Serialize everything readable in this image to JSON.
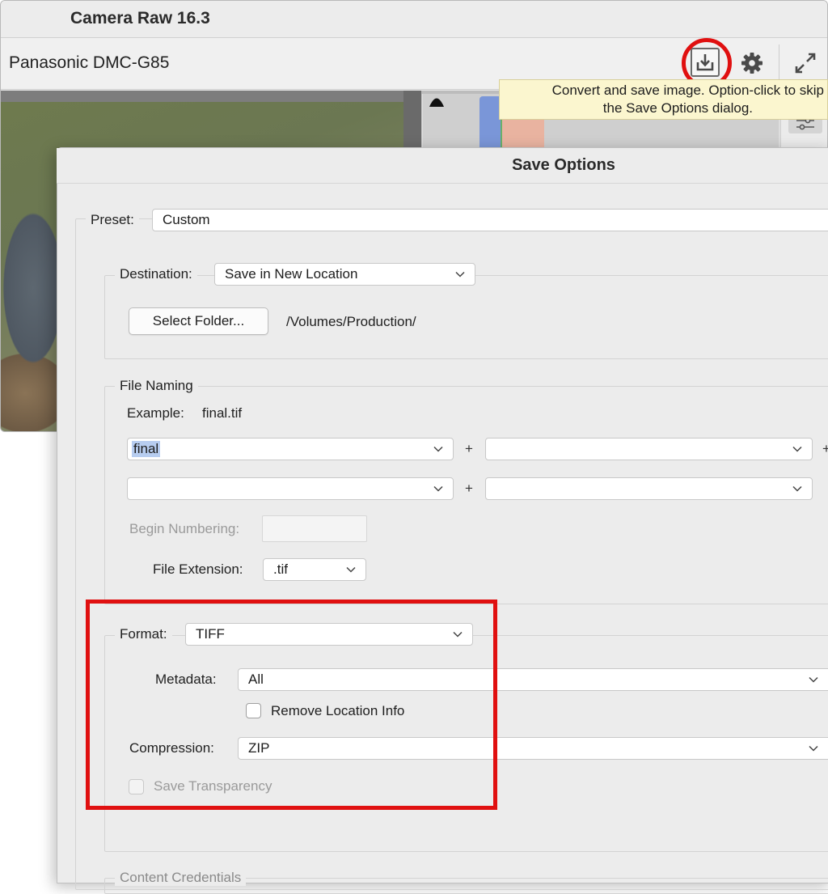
{
  "app": {
    "title": "Camera Raw 16.3",
    "camera_name": "Panasonic DMC-G85",
    "toolbar_icons": [
      "save-image-icon",
      "gear-icon",
      "expand-icon"
    ]
  },
  "tooltip": {
    "line1": "Convert and save image.  Option-click to skip",
    "line2": "the Save Options dialog."
  },
  "dialog": {
    "title": "Save Options",
    "preset_label": "Preset:",
    "preset_value": "Custom",
    "destination": {
      "label": "Destination:",
      "value": "Save in New Location",
      "select_folder_label": "Select Folder...",
      "path": "/Volumes/Production/"
    },
    "file_naming": {
      "group_label": "File Naming",
      "example_label": "Example:",
      "example_value": "final.tif",
      "field1": "final",
      "field2": "",
      "field3": "",
      "field4": "",
      "plus": "+",
      "begin_numbering_label": "Begin Numbering:",
      "begin_numbering_value": "",
      "file_extension_label": "File Extension:",
      "file_extension_value": ".tif"
    },
    "format": {
      "label": "Format:",
      "value": "TIFF",
      "metadata_label": "Metadata:",
      "metadata_value": "All",
      "remove_location_label": "Remove Location Info",
      "remove_location_checked": false,
      "compression_label": "Compression:",
      "compression_value": "ZIP",
      "save_transparency_label": "Save Transparency",
      "save_transparency_checked": false
    },
    "content_credentials_label": "Content Credentials"
  },
  "colors": {
    "highlight": "#e01010",
    "tooltip_bg": "#fbf6cf",
    "selection": "#b7cdf0"
  }
}
